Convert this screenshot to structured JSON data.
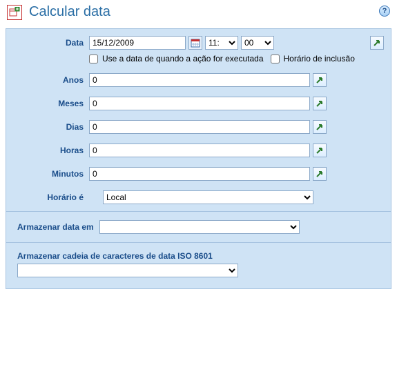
{
  "header": {
    "title": "Calcular data"
  },
  "data_row": {
    "label": "Data",
    "value": "15/12/2009",
    "hour": "11:",
    "minute": "00",
    "chk1_label": "Use a data de quando a ação for executada",
    "chk2_label": "Horário de inclusão"
  },
  "anos": {
    "label": "Anos",
    "value": "0"
  },
  "meses": {
    "label": "Meses",
    "value": "0"
  },
  "dias": {
    "label": "Dias",
    "value": "0"
  },
  "horas": {
    "label": "Horas",
    "value": "0"
  },
  "minutos": {
    "label": "Minutos",
    "value": "0"
  },
  "horario": {
    "label": "Horário é",
    "value": "Local"
  },
  "store": {
    "label": "Armazenar data em",
    "value": ""
  },
  "iso": {
    "label": "Armazenar cadeia de caracteres de data ISO 8601",
    "value": ""
  }
}
